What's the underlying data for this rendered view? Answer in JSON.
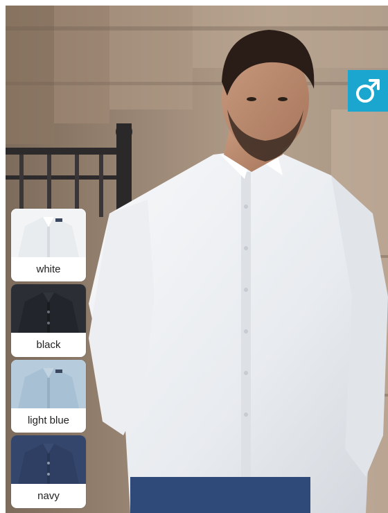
{
  "photo": {
    "subject": "man-in-oxford-shirt",
    "icon": "photo-icon"
  },
  "badge": {
    "icon": "male-symbol-icon",
    "color": "#1aa6cf"
  },
  "swatches": [
    {
      "label": "white",
      "color": "#e9ecef"
    },
    {
      "label": "black",
      "color": "#22252b"
    },
    {
      "label": "light blue",
      "color": "#a8c0d3"
    },
    {
      "label": "navy",
      "color": "#2e3f63"
    }
  ]
}
